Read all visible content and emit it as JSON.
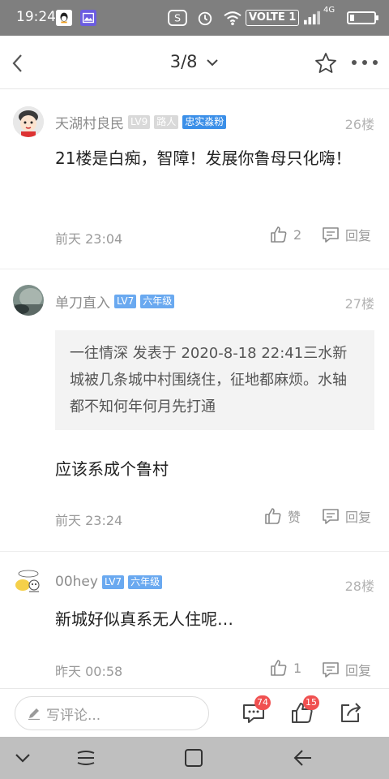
{
  "status_bar": {
    "time": "19:24",
    "network_label": "VOLTE 1",
    "signal_label": "4G"
  },
  "header": {
    "page_indicator": "3/8"
  },
  "posts": [
    {
      "username": "天湖村良民",
      "level": "LV9",
      "badges": [
        "路人",
        "忠实淼粉"
      ],
      "floor": "26楼",
      "content": "21楼是白痴，智障！发展你鲁母只化嗨！",
      "time": "前天 23:04",
      "likes": "2",
      "reply_label": "回复"
    },
    {
      "username": "单刀直入",
      "level": "LV7",
      "badges": [
        "六年级"
      ],
      "floor": "27楼",
      "quote": "一往情深 发表于 2020-8-18 22:41三水新城被几条城中村围绕住，征地都麻烦。水轴都不知何年何月先打通",
      "content": "应该系成个鲁村",
      "time": "前天 23:24",
      "likes": "赞",
      "reply_label": "回复"
    },
    {
      "username": "00hey",
      "level": "LV7",
      "badges": [
        "六年级"
      ],
      "floor": "28楼",
      "content": "新城好似真系无人住呢…",
      "time": "昨天 00:58",
      "likes": "1",
      "reply_label": "回复"
    }
  ],
  "bottom_bar": {
    "comment_placeholder": "写评论...",
    "comment_count": "74",
    "like_count": "15"
  },
  "colors": {
    "accent": "#3b8fe8",
    "badge_red": "#f05050",
    "status_bar": "#7f7f7f"
  }
}
